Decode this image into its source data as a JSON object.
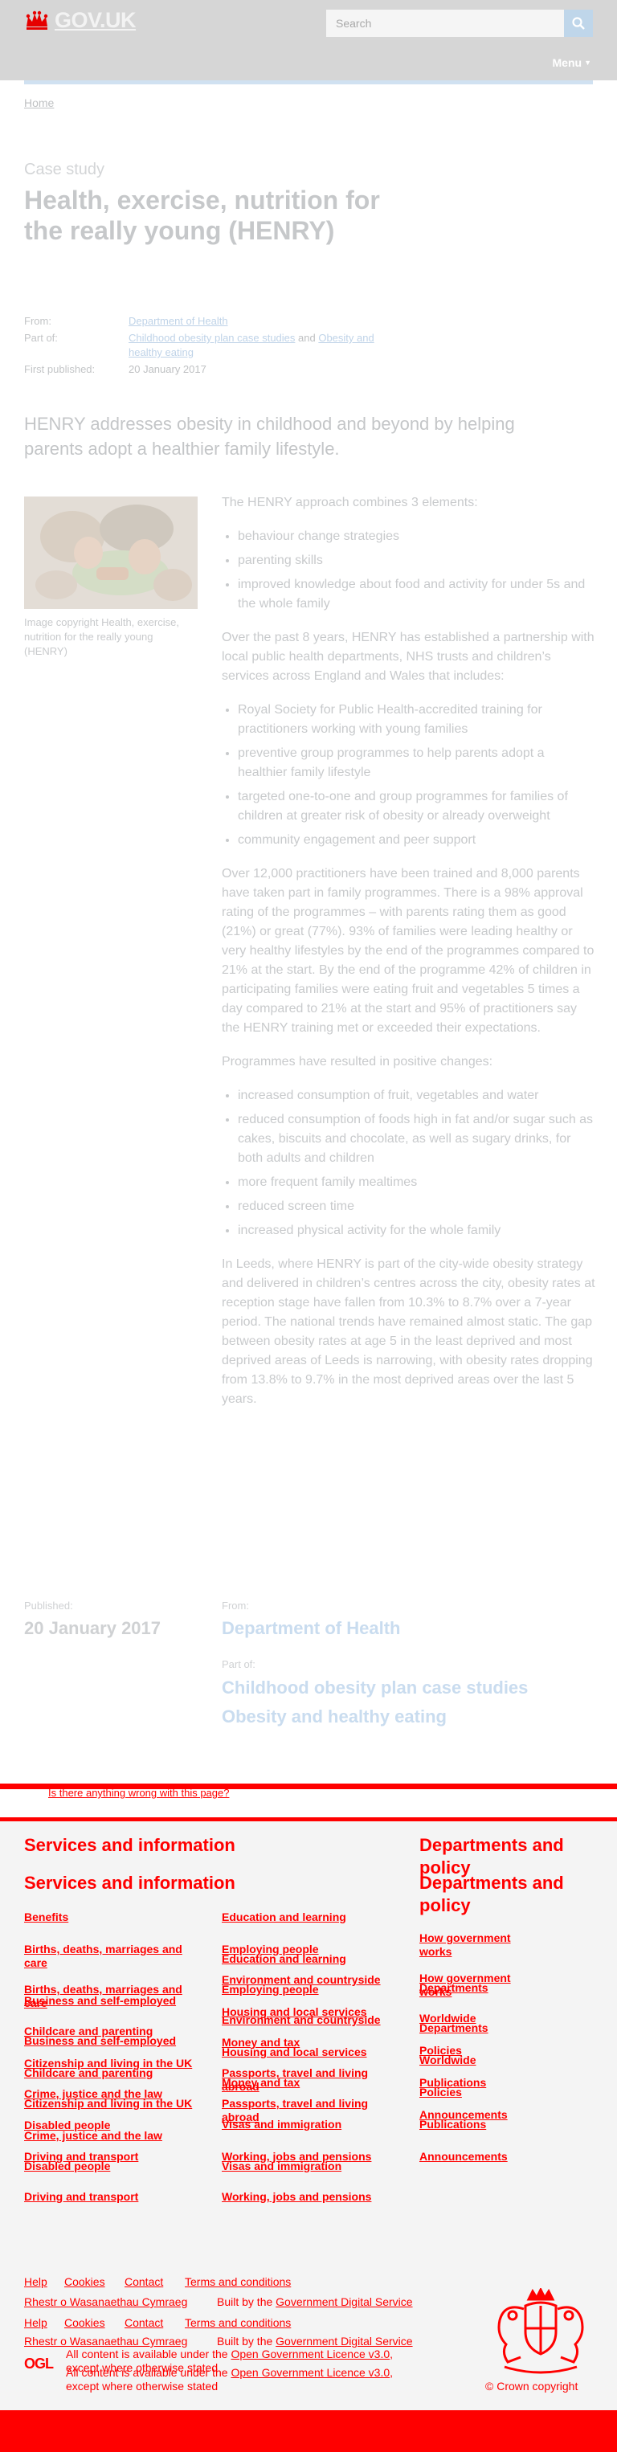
{
  "header": {
    "logo_text": "GOV.UK",
    "search_placeholder": "Search",
    "menu_label": "Menu",
    "icons": {
      "logo": "crown-icon",
      "search": "search-icon",
      "menu": "caret-down-icon"
    }
  },
  "breadcrumb": {
    "home": "Home"
  },
  "page": {
    "content_type": "Case study",
    "title": "Health, exercise, nutrition for the really young (HENRY)",
    "meta": {
      "from_label": "From:",
      "from_value": "Department of Health",
      "partof_label": "Part of:",
      "partof_1": "Childhood obesity plan case studies",
      "partof_and": " and ",
      "partof_2": "Obesity and healthy eating",
      "published_label": "First published:",
      "published_value": "20 January 2017"
    },
    "lead": "HENRY addresses obesity in childhood and beyond by helping parents adopt a healthier family lifestyle.",
    "image_caption": "Image copyright Health, exercise, nutrition for the really young (HENRY)",
    "body": {
      "p1": "The HENRY approach combines 3 elements:",
      "list1": [
        "behaviour change strategies",
        "parenting skills",
        "improved knowledge about food and activity for under 5s and the whole family"
      ],
      "p2": "Over the past 8 years, HENRY has established a partnership with local public health departments, NHS trusts and children’s services across England and Wales that includes:",
      "list2": [
        "Royal Society for Public Health-accredited training for practitioners working with young families",
        "preventive group programmes to help parents adopt a healthier family lifestyle",
        "targeted one-to-one and group programmes for families of children at greater risk of obesity or already overweight",
        "community engagement and peer support"
      ],
      "p3": "Over 12,000 practitioners have been trained and 8,000 parents have taken part in family programmes. There is a 98% approval rating of the programmes – with parents rating them as good (21%) or great (77%). 93% of families were leading healthy or very healthy lifestyles by the end of the programmes compared to 21% at the start. By the end of the programme 42% of children in participating families were eating fruit and vegetables 5 times a day compared to 21% at the start and 95% of practitioners say the HENRY training met or exceeded their expectations.",
      "p4": "Programmes have resulted in positive changes:",
      "list3": [
        "increased consumption of fruit, vegetables and water",
        "reduced consumption of foods high in fat and/or sugar such as cakes, biscuits and chocolate, as well as sugary drinks, for both adults and children",
        "more frequent family mealtimes",
        "reduced screen time",
        "increased physical activity for the whole family"
      ],
      "p5": "In Leeds, where HENRY is part of the city-wide obesity strategy and delivered in children’s centres across the city, obesity rates at reception stage have fallen from 10.3% to 8.7% over a 7-year period. The national trends have remained almost static. The gap between obesity rates at age 5 in the least deprived and most deprived areas of Leeds is narrowing, with obesity rates dropping from 13.8% to 9.7% in the most deprived areas over the last 5 years."
    },
    "published": {
      "label": "Published:",
      "date": "20 January 2017",
      "from_label": "From:",
      "from_value": "Department of Health",
      "partof_label": "Part of:",
      "partof_1": "Childhood obesity plan case studies",
      "partof_2": "Obesity and healthy eating"
    }
  },
  "footer": {
    "report_link": "Is there anything wrong with this page?",
    "services_heading": "Services and information",
    "departments_heading": "Departments and policy",
    "services_col1": [
      "Benefits",
      "Births, deaths, marriages and care",
      "Business and self-employed",
      "Childcare and parenting",
      "Citizenship and living in the UK",
      "Crime, justice and the law",
      "Disabled people",
      "Driving and transport"
    ],
    "services_col2": [
      "Education and learning",
      "Employing people",
      "Environment and countryside",
      "Housing and local services",
      "Money and tax",
      "Passports, travel and living abroad",
      "Visas and immigration",
      "Working, jobs and pensions"
    ],
    "departments": [
      "How government works",
      "Departments",
      "Worldwide",
      "Policies",
      "Publications",
      "Announcements"
    ],
    "bottom_links": [
      "Help",
      "Cookies",
      "Contact",
      "Terms and conditions"
    ],
    "welsh": "Rhestr o Wasanaethau Cymraeg",
    "built_by_prefix": "Built by the ",
    "built_by_link": "Government Digital Service",
    "ogl_logo": "OGL",
    "licence_prefix": "All content is available under the ",
    "licence_link": "Open Government Licence v3.0",
    "licence_suffix": ", except where otherwise stated",
    "copyright": "© Crown copyright"
  },
  "colors": {
    "footer_accent": "#ff0000",
    "link": "#c9dcef",
    "header_bg": "#d6d6d6",
    "footer_bg": "#f4f4f4"
  }
}
